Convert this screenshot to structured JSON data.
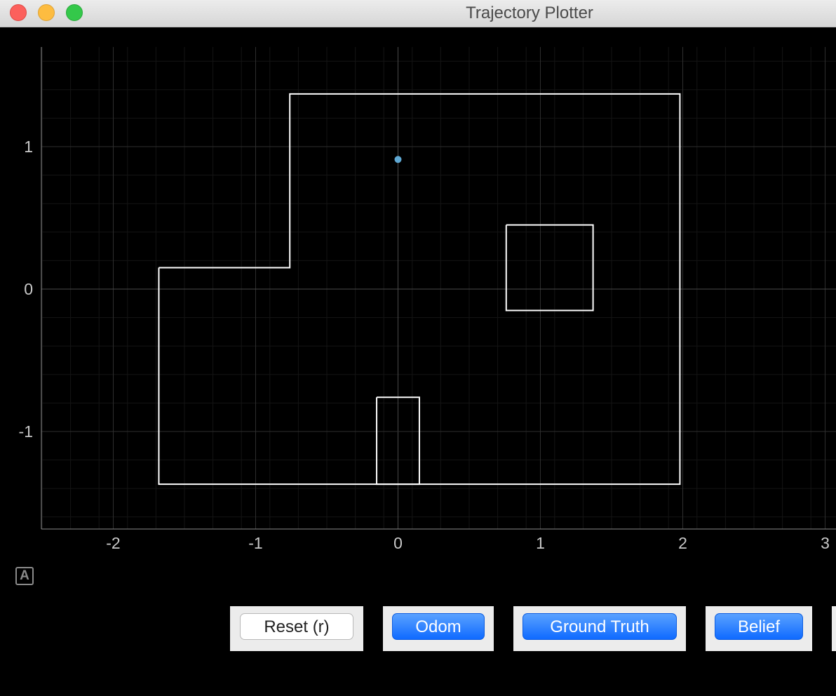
{
  "window": {
    "title": "Trajectory Plotter"
  },
  "chart_data": {
    "type": "scatter",
    "title": "",
    "xlabel": "",
    "ylabel": "",
    "xlim": [
      -2.5,
      3.0
    ],
    "ylim": [
      -1.7,
      1.7
    ],
    "x_ticks": [
      "-2",
      "-1",
      "0",
      "1",
      "2",
      "3"
    ],
    "y_ticks": [
      "1",
      "0",
      "-1"
    ],
    "x_tick_values": [
      -2,
      -1,
      0,
      1,
      2,
      3
    ],
    "y_tick_values": [
      1,
      0,
      -1
    ],
    "grid": true,
    "background": "#000000",
    "walls_color": "#ffffff",
    "walls": [
      {
        "name": "boundary",
        "points": [
          [
            -1.68,
            0.15
          ],
          [
            -0.76,
            0.15
          ],
          [
            -0.76,
            1.37
          ],
          [
            1.98,
            1.37
          ],
          [
            1.98,
            -1.37
          ],
          [
            -1.68,
            -1.37
          ],
          [
            -1.68,
            0.15
          ]
        ]
      },
      {
        "name": "obstacle",
        "points": [
          [
            0.76,
            0.45
          ],
          [
            1.37,
            0.45
          ],
          [
            1.37,
            -0.15
          ],
          [
            0.76,
            -0.15
          ],
          [
            0.76,
            0.45
          ]
        ]
      },
      {
        "name": "obstacle",
        "points": [
          [
            -0.15,
            -0.76
          ],
          [
            0.15,
            -0.76
          ],
          [
            0.15,
            -1.37
          ],
          [
            -0.15,
            -1.37
          ],
          [
            -0.15,
            -0.76
          ]
        ]
      }
    ],
    "points": [
      {
        "x": 0.0,
        "y": 0.91,
        "color": "#5fa8d3"
      }
    ]
  },
  "plot": {
    "autoscale_icon": "A"
  },
  "buttons": {
    "reset": "Reset (r)",
    "odom": "Odom",
    "ground_truth": "Ground Truth",
    "belief": "Belief"
  }
}
